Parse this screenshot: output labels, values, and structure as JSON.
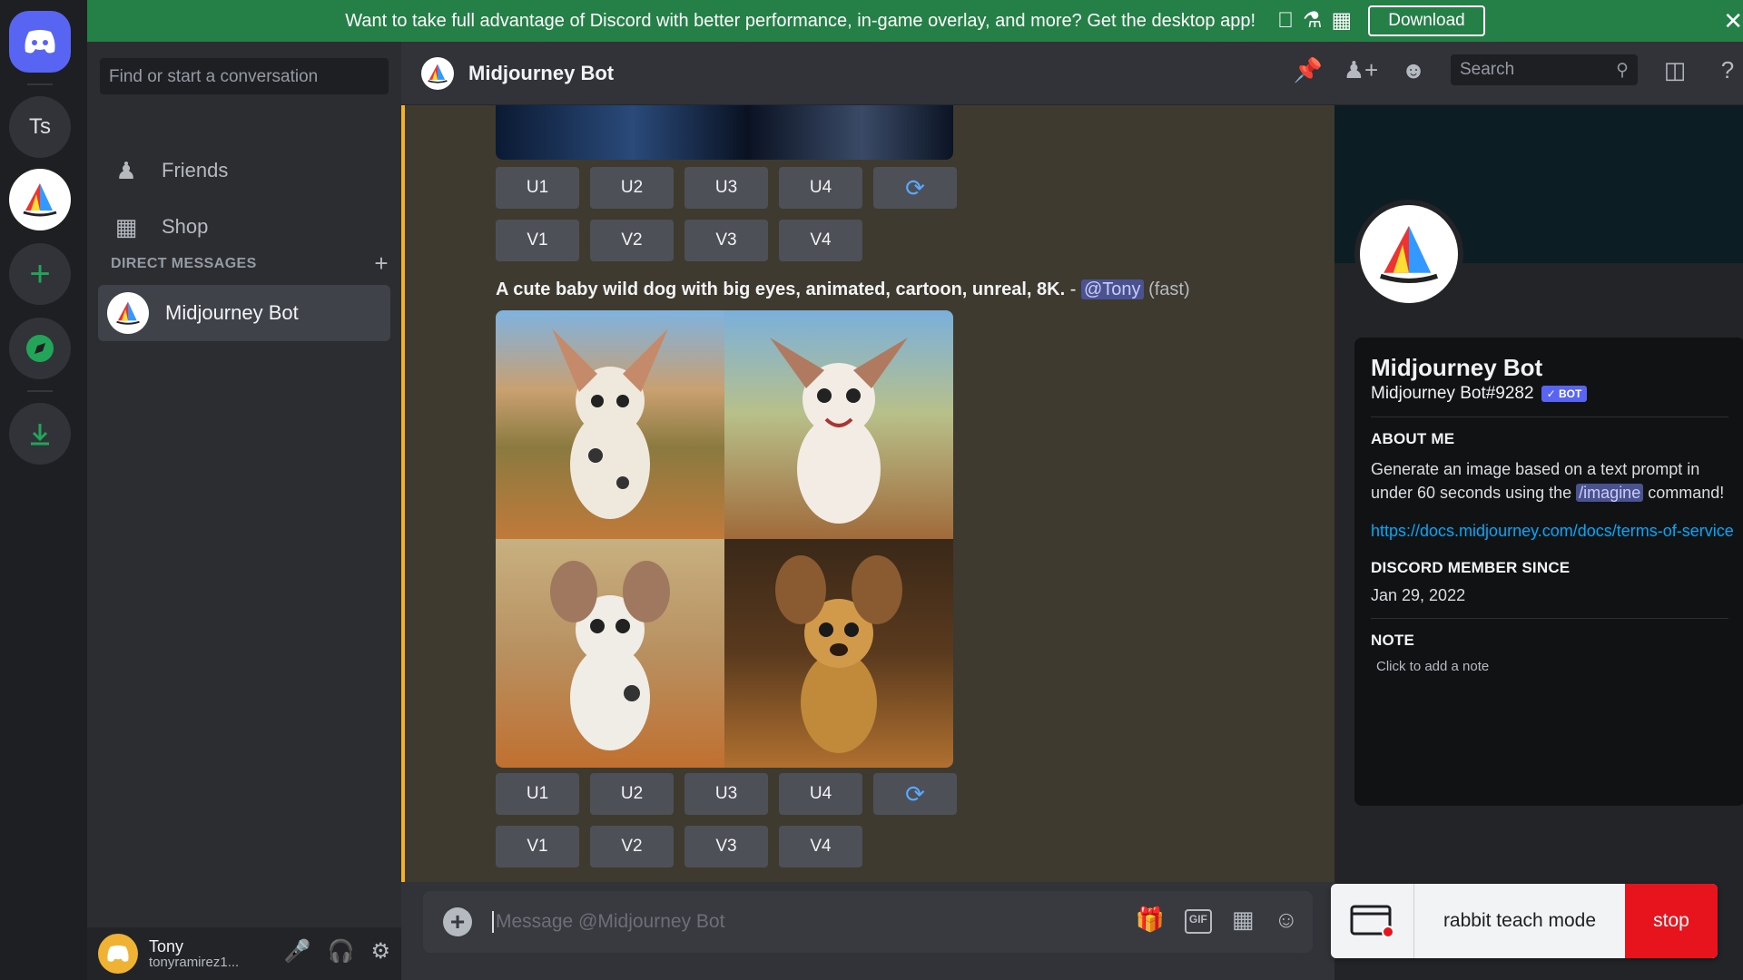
{
  "banner": {
    "text": "Want to take full advantage of Discord with better performance, in-game overlay, and more? Get the desktop app!",
    "download": "Download",
    "close": "✕"
  },
  "rail": {
    "server_ts": "Ts"
  },
  "sidebar": {
    "search_placeholder": "Find or start a conversation",
    "friends": "Friends",
    "shop": "Shop",
    "dm_header": "DIRECT MESSAGES",
    "dm_add": "+",
    "dm_item": "Midjourney Bot"
  },
  "userbar": {
    "name": "Tony",
    "handle": "tonyramirez1..."
  },
  "chat": {
    "title": "Midjourney Bot",
    "search_placeholder": "Search",
    "prompt_text": "A cute baby wild dog with big eyes, animated, cartoon, unreal, 8K.",
    "prompt_sep": " - ",
    "mention": "@Tony",
    "speed": "(fast)",
    "u_buttons": [
      "U1",
      "U2",
      "U3",
      "U4"
    ],
    "v_buttons": [
      "V1",
      "V2",
      "V3",
      "V4"
    ],
    "refresh_icon": "refresh-icon",
    "composer_placeholder": "Message @Midjourney Bot",
    "gif_label": "GIF"
  },
  "profile": {
    "name": "Midjourney Bot",
    "tag": "Midjourney Bot#9282",
    "badge": "✓ BOT",
    "about_title": "ABOUT ME",
    "about_text_1": "Generate an image based on a text prompt in under 60 seconds using the ",
    "about_cmd": "/imagine",
    "about_text_2": " command!",
    "link": "https://docs.midjourney.com/docs/terms-of-service",
    "member_title": "DISCORD MEMBER SINCE",
    "member_since": "Jan 29, 2022",
    "note_title": "NOTE",
    "note_placeholder": "Click to add a note"
  },
  "overlay": {
    "label": "rabbit teach mode",
    "stop": "stop"
  },
  "colors": {
    "banner": "#248046",
    "accent": "#5865f2",
    "mention_bg": "#4b5290",
    "stop": "#e8141d",
    "link": "#00a8fc"
  }
}
